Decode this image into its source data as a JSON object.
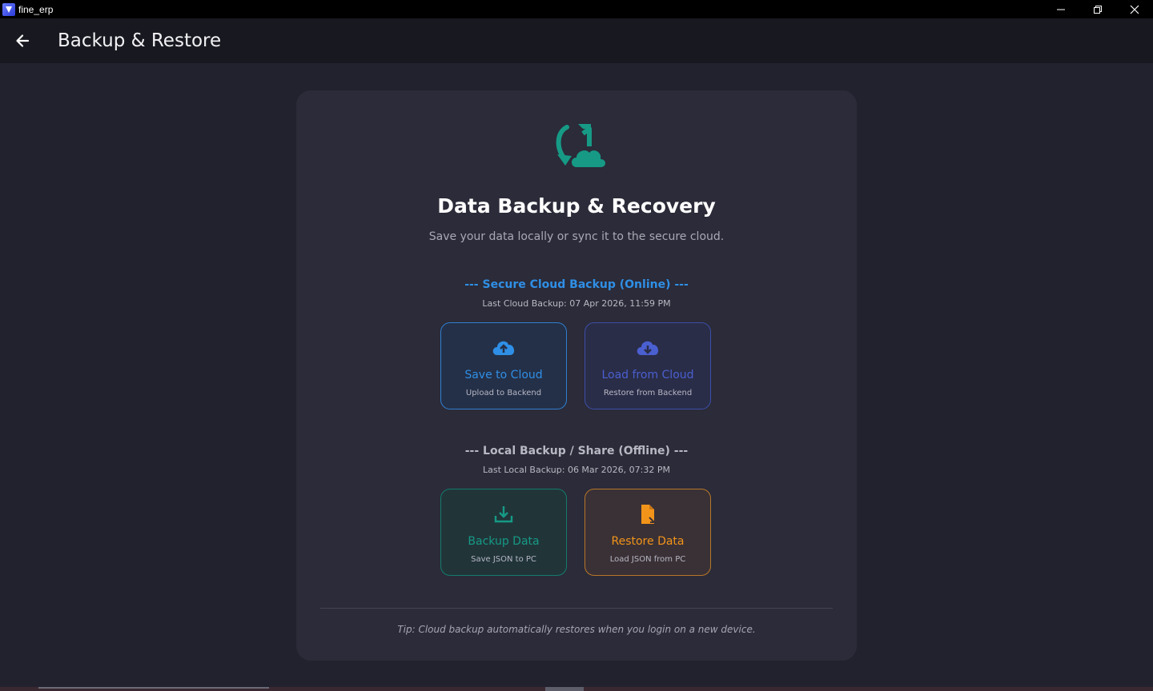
{
  "window": {
    "title": "fine_erp",
    "controls": [
      "minimize-icon",
      "restore-icon",
      "close-icon"
    ]
  },
  "appbar": {
    "back_icon": "arrow-left-icon",
    "title": "Backup & Restore"
  },
  "card": {
    "hero_icon": "sync-cloud-icon",
    "heading": "Data Backup & Recovery",
    "subheading": "Save your data locally or sync it to the secure cloud.",
    "cloud_section": {
      "title": "--- Secure Cloud Backup (Online) ---",
      "last_backup": "Last Cloud Backup: 07 Apr 2026, 11:59 PM",
      "title_color": "#2f8fe6",
      "tiles": [
        {
          "label": "Save to Cloud",
          "sub": "Upload to Backend",
          "icon": "cloud-upload-icon",
          "color": "#2f8fe6"
        },
        {
          "label": "Load from Cloud",
          "sub": "Restore from Backend",
          "icon": "cloud-download-icon",
          "color": "#4a5fd0"
        }
      ]
    },
    "local_section": {
      "title": "--- Local Backup / Share (Offline) ---",
      "last_backup": "Last Local Backup: 06 Mar 2026, 07:32 PM",
      "title_color": "#b8b8c4",
      "tiles": [
        {
          "label": "Backup Data",
          "sub": "Save JSON to PC",
          "icon": "download-tray-icon",
          "color": "#169a86"
        },
        {
          "label": "Restore Data",
          "sub": "Load JSON from PC",
          "icon": "file-restore-icon",
          "color": "#f2941a"
        }
      ]
    },
    "tip": "Tip: Cloud backup automatically restores when you login on a new device."
  },
  "colors": {
    "background": "#22222e",
    "card": "#2b2b39",
    "accent_teal": "#169a86"
  }
}
